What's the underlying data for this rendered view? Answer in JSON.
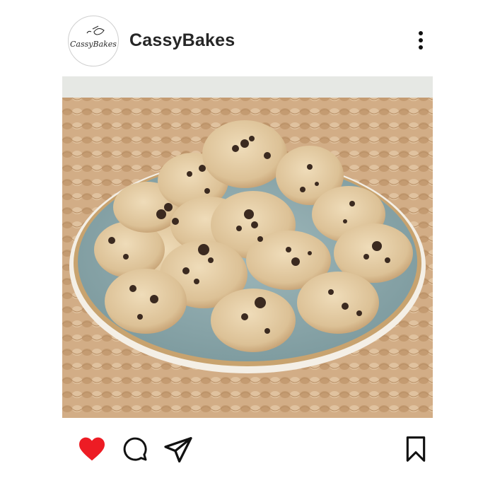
{
  "post": {
    "username": "CassyBakes",
    "avatar_text": "CassyBakes",
    "image_description_icon": "photo",
    "liked": true
  },
  "icons": {
    "more": "more-vertical-icon",
    "like": "heart-icon",
    "comment": "comment-icon",
    "share": "send-icon",
    "save": "bookmark-icon",
    "avatar_whisk": "whisk-icon"
  },
  "colors": {
    "like_red": "#ed1c24",
    "text_dark": "#262626",
    "plate_blue": "#8ea9ac",
    "placemat": "#c9a27a"
  }
}
